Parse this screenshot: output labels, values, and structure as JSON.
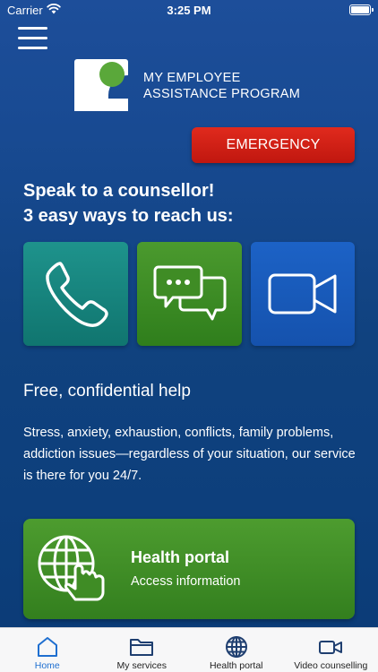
{
  "status_bar": {
    "carrier": "Carrier",
    "time": "3:25 PM"
  },
  "brand": {
    "line1": "MY EMPLOYEE",
    "line2": "ASSISTANCE PROGRAM"
  },
  "emergency_label": "EMERGENCY",
  "headline": {
    "line1": "Speak to a counsellor!",
    "line2": "3 easy ways to reach us:"
  },
  "contact_options": [
    {
      "icon": "phone-icon",
      "color": "#17857e"
    },
    {
      "icon": "chat-icon",
      "color": "#3f8c25"
    },
    {
      "icon": "video-icon",
      "color": "#1a5cbd"
    }
  ],
  "section": {
    "title": "Free, confidential help",
    "body": "Stress, anxiety, exhaustion, conflicts, family problems, addiction issues—regardless of your situation, our service is there for you 24/7."
  },
  "portal_card": {
    "title": "Health portal",
    "subtitle": "Access information",
    "icon": "globe-touch-icon"
  },
  "tabs": [
    {
      "label": "Home",
      "icon": "home-icon",
      "active": true
    },
    {
      "label": "My services",
      "icon": "folder-icon",
      "active": false
    },
    {
      "label": "Health portal",
      "icon": "globe-icon",
      "active": false
    },
    {
      "label": "Video counselling",
      "icon": "video-icon",
      "active": false
    }
  ],
  "colors": {
    "background": "#154689",
    "emergency": "#d4221a",
    "tab_active": "#1f6fd0",
    "logo_green": "#5aa83a"
  }
}
